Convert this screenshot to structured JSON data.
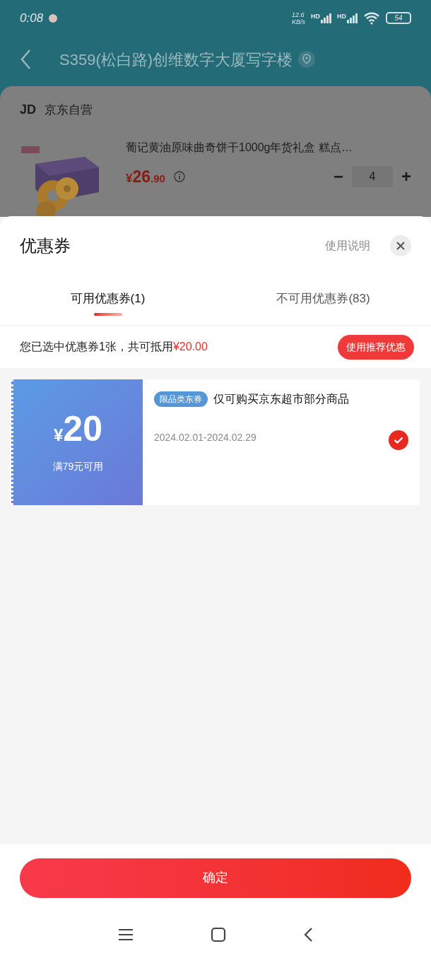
{
  "status_bar": {
    "time": "0:08",
    "net_speed": [
      "12.6",
      "KB/s"
    ],
    "signal_labels": [
      "HD",
      "HD"
    ],
    "battery": "54"
  },
  "header": {
    "title": "S359(松白路)创维数字大厦写字楼"
  },
  "store": {
    "logo": "JD",
    "name": "京东自营"
  },
  "product": {
    "title": "葡记黄油原味曲奇饼干1000g年货礼盒 糕点…",
    "price_symbol": "¥",
    "price_int": "26",
    "price_dec": ".90",
    "quantity": "4",
    "minus": "−",
    "plus": "+"
  },
  "sheet": {
    "title": "优惠券",
    "help": "使用说明",
    "tabs": [
      {
        "label": "可用优惠券(1)",
        "selected": true
      },
      {
        "label": "不可用优惠券(83)",
        "selected": false
      }
    ],
    "summary": {
      "text": "您已选中优惠券1张，共可抵用",
      "amount": "¥20.00"
    },
    "recommend_button": "使用推荐优惠",
    "coupons": [
      {
        "currency": "¥",
        "amount": "20",
        "condition": "满79元可用",
        "tag": "限品类东券",
        "description": "仅可购买京东超市部分商品",
        "date": "2024.02.01-2024.02.29",
        "selected": true
      }
    ],
    "confirm_button": "确定"
  }
}
